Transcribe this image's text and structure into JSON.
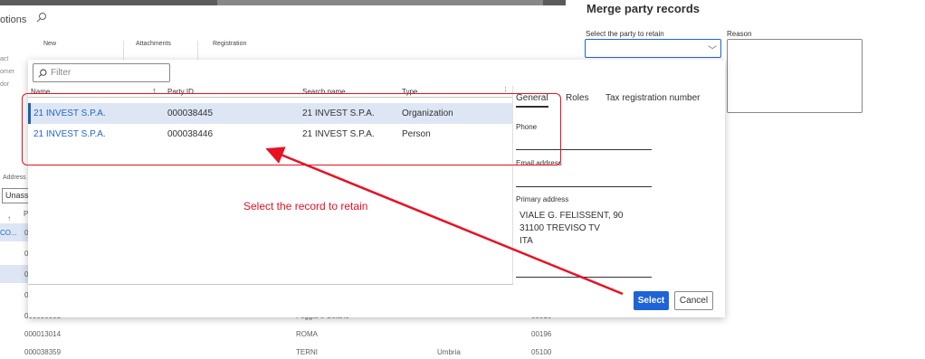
{
  "background": {
    "options_label": "otions",
    "groups": [
      "New",
      "Attachments",
      "Registration"
    ],
    "side_labels": [
      "act",
      "omer",
      "dor"
    ],
    "address_label": "Address",
    "address_value": "Unass",
    "rows": [
      {
        "c1": "CO...",
        "c2": "0"
      },
      {
        "c1": "",
        "c2": "0"
      },
      {
        "c1": "",
        "c2": "0"
      },
      {
        "c1": "",
        "c2": "0"
      },
      {
        "c1": "",
        "c2": "000000001",
        "c3": "Foggia e Colano",
        "c5": "00016"
      },
      {
        "c1": "",
        "c2": "000013014",
        "c3": "ROMA",
        "c4": "",
        "c5": "00196"
      },
      {
        "c1": "",
        "c2": "000038359",
        "c3": "TERNI",
        "c4": "Umbria",
        "c5": "05100"
      }
    ],
    "header_p": "P"
  },
  "lookup": {
    "filter_placeholder": "Filter",
    "columns": {
      "name": "Name",
      "party_id": "Party ID",
      "search_name": "Search name",
      "type": "Type"
    },
    "rows": [
      {
        "name": "21 INVEST S.P.A.",
        "party_id": "000038445",
        "search_name": "21 INVEST S.P.A.",
        "type": "Organization",
        "selected": true
      },
      {
        "name": "21 INVEST S.P.A.",
        "party_id": "000038446",
        "search_name": "21 INVEST S.P.A.",
        "type": "Person",
        "selected": false
      }
    ],
    "tabs": [
      "General",
      "Roles",
      "Tax registration number"
    ],
    "details": {
      "phone_label": "Phone",
      "email_label": "Email address",
      "address_label": "Primary address",
      "address_lines": [
        "VIALE G. FELISSENT, 90",
        "31100 TREVISO TV",
        "ITA"
      ]
    },
    "select_label": "Select",
    "cancel_label": "Cancel"
  },
  "merge_panel": {
    "title": "Merge party records",
    "retain_label": "Select the party to retain",
    "retain_value": "",
    "reason_label": "Reason"
  },
  "annotation": {
    "text": "Select the record to retain",
    "color": "#e81123"
  },
  "colors": {
    "accent": "#1f63d9",
    "selected_row": "#dee6f5",
    "link": "#2266c4"
  }
}
